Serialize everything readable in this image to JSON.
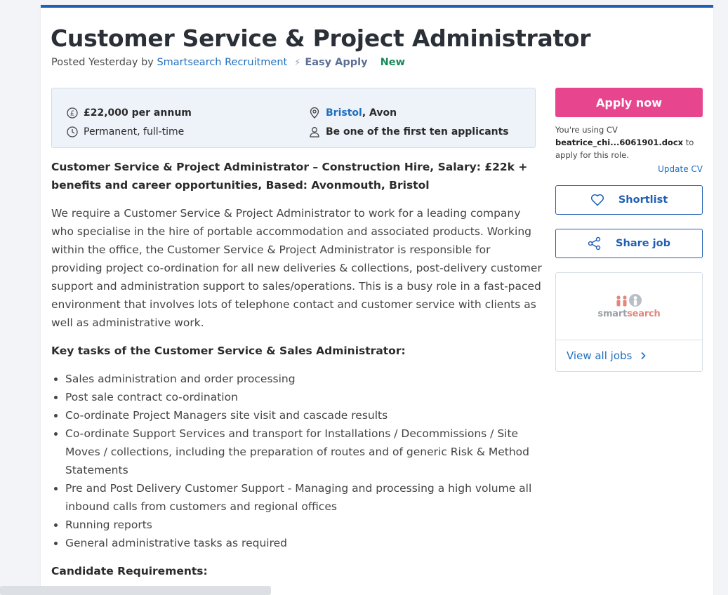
{
  "job": {
    "title": "Customer Service & Project Administrator",
    "posted_prefix": "Posted Yesterday by",
    "recruiter": "Smartsearch Recruitment",
    "easy_apply": "Easy Apply",
    "new_badge": "New"
  },
  "summary": {
    "salary": "£22,000 per annum",
    "type": "Permanent, full-time",
    "location_city": "Bristol",
    "location_region": ", Avon",
    "applicants": "Be one of the first ten applicants"
  },
  "description": {
    "intro_heading": "Customer Service & Project Administrator – Construction Hire, Salary: £22k + benefits and career opportunities, Based: Avonmouth, Bristol",
    "paragraph": "We require a Customer Service & Project Administrator to work for a leading company who specialise in the hire of portable accommodation and associated products. Working within the office, the Customer Service & Project Administrator is responsible for providing project co-ordination for all new deliveries & collections, post-delivery customer support and administration support to sales/operations. This is a busy role in a fast-paced environment that involves lots of telephone contact and customer service with clients as well as administrative work.",
    "tasks_heading": "Key tasks of the Customer Service & Sales Administrator:",
    "tasks": [
      "Sales administration and order processing",
      "Post sale contract co-ordination",
      "Co-ordinate Project Managers site visit and cascade results",
      "Co-ordinate Support Services and transport for Installations / Decommissions / Site Moves / collections, including the preparation of routes and of generic Risk & Method Statements",
      "Pre and Post Delivery Customer Support - Managing and processing a high volume all inbound calls from customers and regional offices",
      "Running reports",
      "General administrative tasks as required"
    ],
    "requirements_heading": "Candidate Requirements:"
  },
  "sidebar": {
    "apply_label": "Apply now",
    "cv_prefix": "You're using CV",
    "cv_file": "beatrice_chi...6061901.docx",
    "cv_suffix": "to apply for this role.",
    "update_cv": "Update CV",
    "shortlist_label": "Shortlist",
    "share_label": "Share job",
    "logo_text_a": "smart",
    "logo_text_b": "search",
    "view_all_jobs": "View all jobs"
  },
  "colors": {
    "accent": "#1f5fb5",
    "apply": "#e8458f",
    "link": "#1f6fbf",
    "new": "#1a8a5a"
  }
}
